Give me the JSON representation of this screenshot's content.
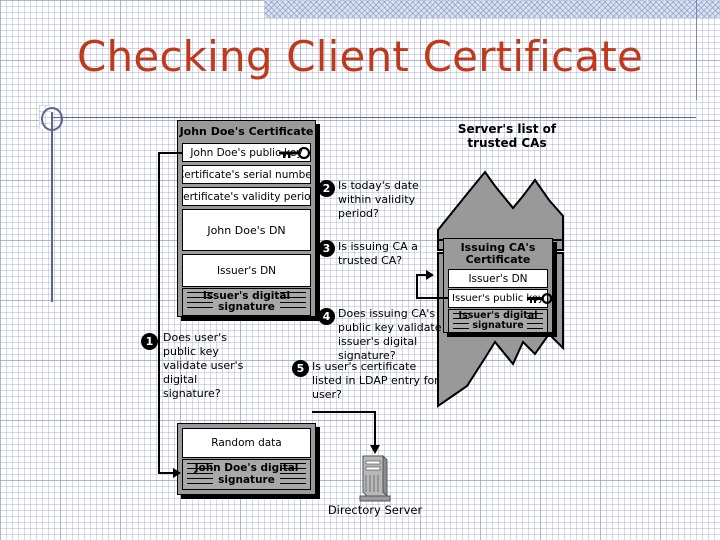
{
  "slide": {
    "title": "Checking Client Certificate",
    "title_color": "#c0391b"
  },
  "client_certificate": {
    "heading": "John Doe's Certificate",
    "rows": [
      "John Doe's public key",
      "Certificate's serial number",
      "Certificate's validity period",
      "John Doe's DN",
      "Issuer's DN"
    ],
    "signature": "Issuer's digital signature",
    "key_icon": "key-icon"
  },
  "signed_data_box": {
    "random_data": "Random data",
    "signature": "John Doe's digital signature"
  },
  "trusted_ca_list": {
    "label_line1": "Server's list of",
    "label_line2": "trusted CAs",
    "fill_color": "#999999"
  },
  "ca_certificate": {
    "heading_line1": "Issuing CA's",
    "heading_line2": "Certificate",
    "rows": [
      "Issuer's DN",
      "Issuer's public key"
    ],
    "signature": "Issuer's digital signature",
    "key_icon": "key-icon"
  },
  "directory_server": {
    "label": "Directory Server",
    "icon": "server-tower-icon"
  },
  "steps": [
    {
      "number": "1",
      "text": "Does user's\npublic key\nvalidate user's\ndigital signature?"
    },
    {
      "number": "2",
      "text": "Is today's date\nwithin validity period?"
    },
    {
      "number": "3",
      "text": "Is issuing CA a\ntrusted CA?"
    },
    {
      "number": "4",
      "text": "Does issuing CA's\npublic key validate\nissuer's digital signature?"
    },
    {
      "number": "5",
      "text": "Is user's certificate\nlisted in LDAP entry for\nuser?"
    }
  ]
}
